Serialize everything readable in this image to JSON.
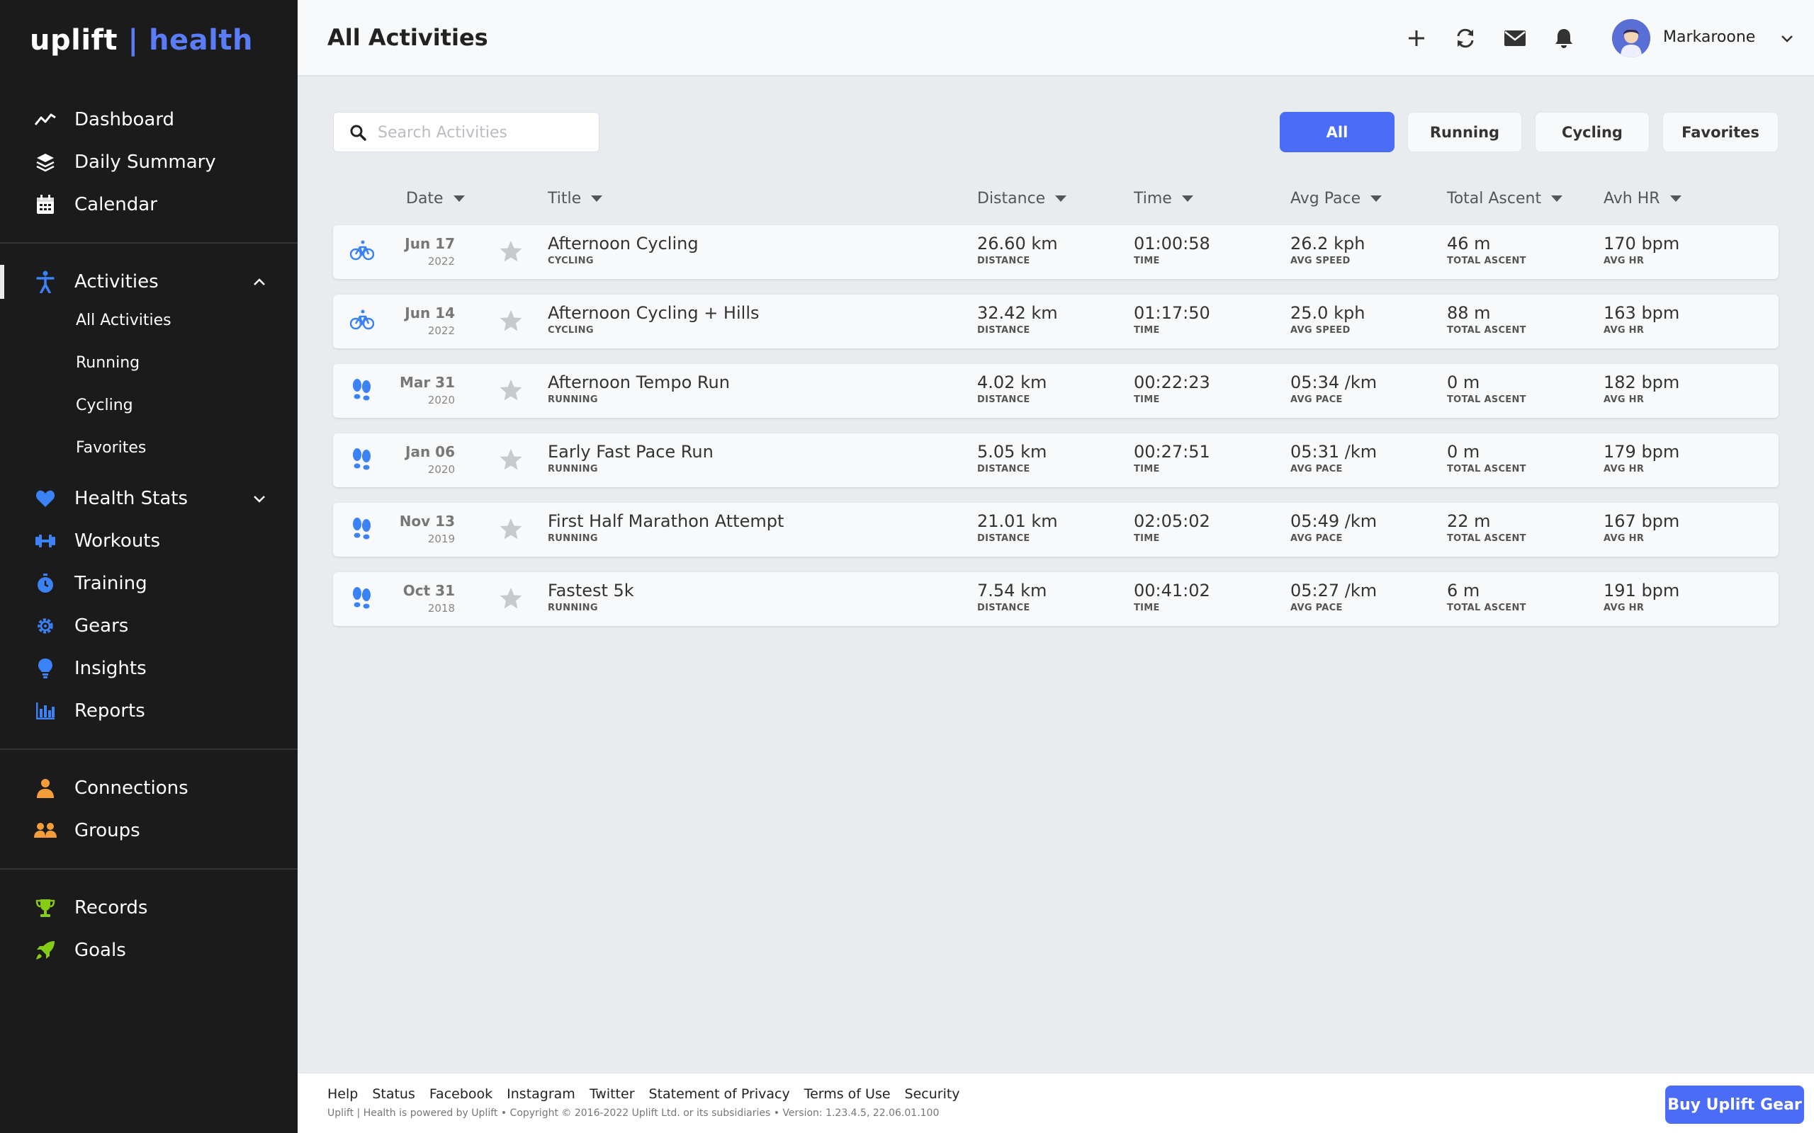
{
  "brand": {
    "part1": "uplift",
    "separator": "|",
    "part2": "health",
    "accent": "#5a7cf6"
  },
  "sidebar": {
    "main": [
      {
        "label": "Dashboard",
        "icon": "trend-icon"
      },
      {
        "label": "Daily Summary",
        "icon": "layers-icon"
      },
      {
        "label": "Calendar",
        "icon": "calendar-icon"
      }
    ],
    "activities": {
      "label": "Activities",
      "icon": "running-person-icon",
      "expanded": true,
      "sub": [
        "All Activities",
        "Running",
        "Cycling",
        "Favorites"
      ]
    },
    "health": [
      {
        "label": "Health Stats",
        "icon": "heart-icon",
        "expandable": true
      },
      {
        "label": "Workouts",
        "icon": "dumbbell-icon"
      },
      {
        "label": "Training",
        "icon": "stopwatch-icon"
      },
      {
        "label": "Gears",
        "icon": "gear-icon"
      },
      {
        "label": "Insights",
        "icon": "lightbulb-icon"
      },
      {
        "label": "Reports",
        "icon": "bar-chart-icon"
      }
    ],
    "social": [
      {
        "label": "Connections",
        "icon": "person-icon"
      },
      {
        "label": "Groups",
        "icon": "group-icon"
      }
    ],
    "achievements": [
      {
        "label": "Records",
        "icon": "trophy-icon"
      },
      {
        "label": "Goals",
        "icon": "rocket-icon"
      }
    ]
  },
  "header": {
    "title": "All Activities",
    "username": "Markaroone"
  },
  "search": {
    "placeholder": "Search Activities"
  },
  "filters": [
    "All",
    "Running",
    "Cycling",
    "Favorites"
  ],
  "columns": [
    "Date",
    "Title",
    "Distance",
    "Time",
    "Avg Pace",
    "Total Ascent",
    "Avh HR"
  ],
  "activities": [
    {
      "type": "cycling",
      "month_day": "Jun 17",
      "year": "2022",
      "title": "Afternoon Cycling",
      "category": "CYCLING",
      "distance": "26.60 km",
      "distance_sub": "DISTANCE",
      "time": "01:00:58",
      "time_sub": "TIME",
      "pace": "26.2 kph",
      "pace_sub": "AVG SPEED",
      "ascent": "46 m",
      "ascent_sub": "TOTAL ASCENT",
      "hr": "170 bpm",
      "hr_sub": "AVG HR"
    },
    {
      "type": "cycling",
      "month_day": "Jun 14",
      "year": "2022",
      "title": "Afternoon Cycling + Hills",
      "category": "CYCLING",
      "distance": "32.42 km",
      "distance_sub": "DISTANCE",
      "time": "01:17:50",
      "time_sub": "TIME",
      "pace": "25.0 kph",
      "pace_sub": "AVG SPEED",
      "ascent": "88 m",
      "ascent_sub": "TOTAL ASCENT",
      "hr": "163 bpm",
      "hr_sub": "AVG HR"
    },
    {
      "type": "running",
      "month_day": "Mar 31",
      "year": "2020",
      "title": "Afternoon Tempo Run",
      "category": "RUNNING",
      "distance": "4.02 km",
      "distance_sub": "DISTANCE",
      "time": "00:22:23",
      "time_sub": "TIME",
      "pace": "05:34 /km",
      "pace_sub": "AVG PACE",
      "ascent": "0 m",
      "ascent_sub": "TOTAL ASCENT",
      "hr": "182 bpm",
      "hr_sub": "AVG HR"
    },
    {
      "type": "running",
      "month_day": "Jan 06",
      "year": "2020",
      "title": "Early Fast Pace Run",
      "category": "RUNNING",
      "distance": "5.05 km",
      "distance_sub": "DISTANCE",
      "time": "00:27:51",
      "time_sub": "TIME",
      "pace": "05:31 /km",
      "pace_sub": "AVG PACE",
      "ascent": "0 m",
      "ascent_sub": "TOTAL ASCENT",
      "hr": "179 bpm",
      "hr_sub": "AVG HR"
    },
    {
      "type": "running",
      "month_day": "Nov 13",
      "year": "2019",
      "title": "First Half Marathon Attempt",
      "category": "RUNNING",
      "distance": "21.01 km",
      "distance_sub": "DISTANCE",
      "time": "02:05:02",
      "time_sub": "TIME",
      "pace": "05:49 /km",
      "pace_sub": "AVG PACE",
      "ascent": "22 m",
      "ascent_sub": "TOTAL ASCENT",
      "hr": "167 bpm",
      "hr_sub": "AVG HR"
    },
    {
      "type": "running",
      "month_day": "Oct 31",
      "year": "2018",
      "title": "Fastest 5k",
      "category": "RUNNING",
      "distance": "7.54 km",
      "distance_sub": "DISTANCE",
      "time": "00:41:02",
      "time_sub": "TIME",
      "pace": "05:27 /km",
      "pace_sub": "AVG PACE",
      "ascent": "6 m",
      "ascent_sub": "TOTAL ASCENT",
      "hr": "191 bpm",
      "hr_sub": "AVG HR"
    }
  ],
  "footer": {
    "links": [
      "Help",
      "Status",
      "Facebook",
      "Instagram",
      "Twitter",
      "Statement of Privacy",
      "Terms of Use",
      "Security"
    ],
    "copyright": "Uplift | Health is powered by Uplift • Copyright © 2016-2022 Uplift Ltd. or its subsidiaries • Version: 1.23.4.5, 22.06.01.100",
    "cta": "Buy Uplift Gear"
  },
  "colors": {
    "primary": "#4a6cf7",
    "sidebar_bg": "#1b1b1b",
    "icon_blue": "#3b82f6",
    "icon_orange": "#f59e3b",
    "icon_green": "#84cc16"
  }
}
